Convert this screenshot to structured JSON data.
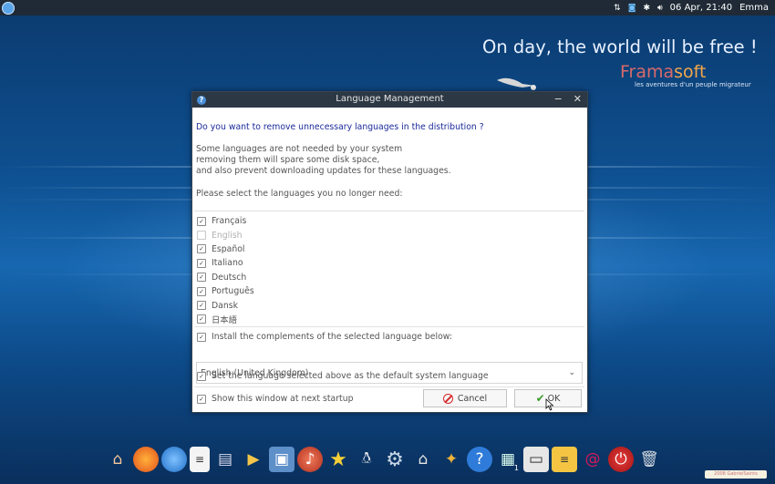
{
  "top_panel": {
    "date_time": "06 Apr, 21:40",
    "user": "Emma",
    "tray_icons": [
      "network-transfer-icon",
      "update-icon",
      "settings-icon",
      "volume-icon"
    ]
  },
  "wallpaper": {
    "slogan": "On day, the world will be free !",
    "brand_part1": "Frama",
    "brand_part2": "soft",
    "tagline": "les aventures d'un peuple migrateur"
  },
  "dialog": {
    "title": "Language Management",
    "question": "Do you want to remove unnecessary languages in the distribution ?",
    "explanation": [
      "Some languages are not needed by your system",
      "removing them will spare some disk space,",
      "and also prevent downloading updates for these languages."
    ],
    "prompt": "Please select the languages you no longer need:",
    "languages": [
      {
        "label": "Français",
        "checked": true,
        "enabled": true
      },
      {
        "label": "English",
        "checked": false,
        "enabled": false
      },
      {
        "label": "Español",
        "checked": true,
        "enabled": true
      },
      {
        "label": "Italiano",
        "checked": true,
        "enabled": true
      },
      {
        "label": "Deutsch",
        "checked": true,
        "enabled": true
      },
      {
        "label": "Português",
        "checked": true,
        "enabled": true
      },
      {
        "label": "Dansk",
        "checked": true,
        "enabled": true
      },
      {
        "label": "日本語",
        "checked": true,
        "enabled": true
      }
    ],
    "install_complements_label": "Install the complements of the selected language below:",
    "selected_language": "English (United Kingdom)",
    "set_default_label": "Set the language selected above as the default system language",
    "show_at_startup_label": "Show this window at next startup",
    "cancel_label": "Cancel",
    "ok_label": "OK"
  },
  "dock": {
    "workspace_number": "1",
    "tray_badge": "2008 GabrielSaints"
  }
}
